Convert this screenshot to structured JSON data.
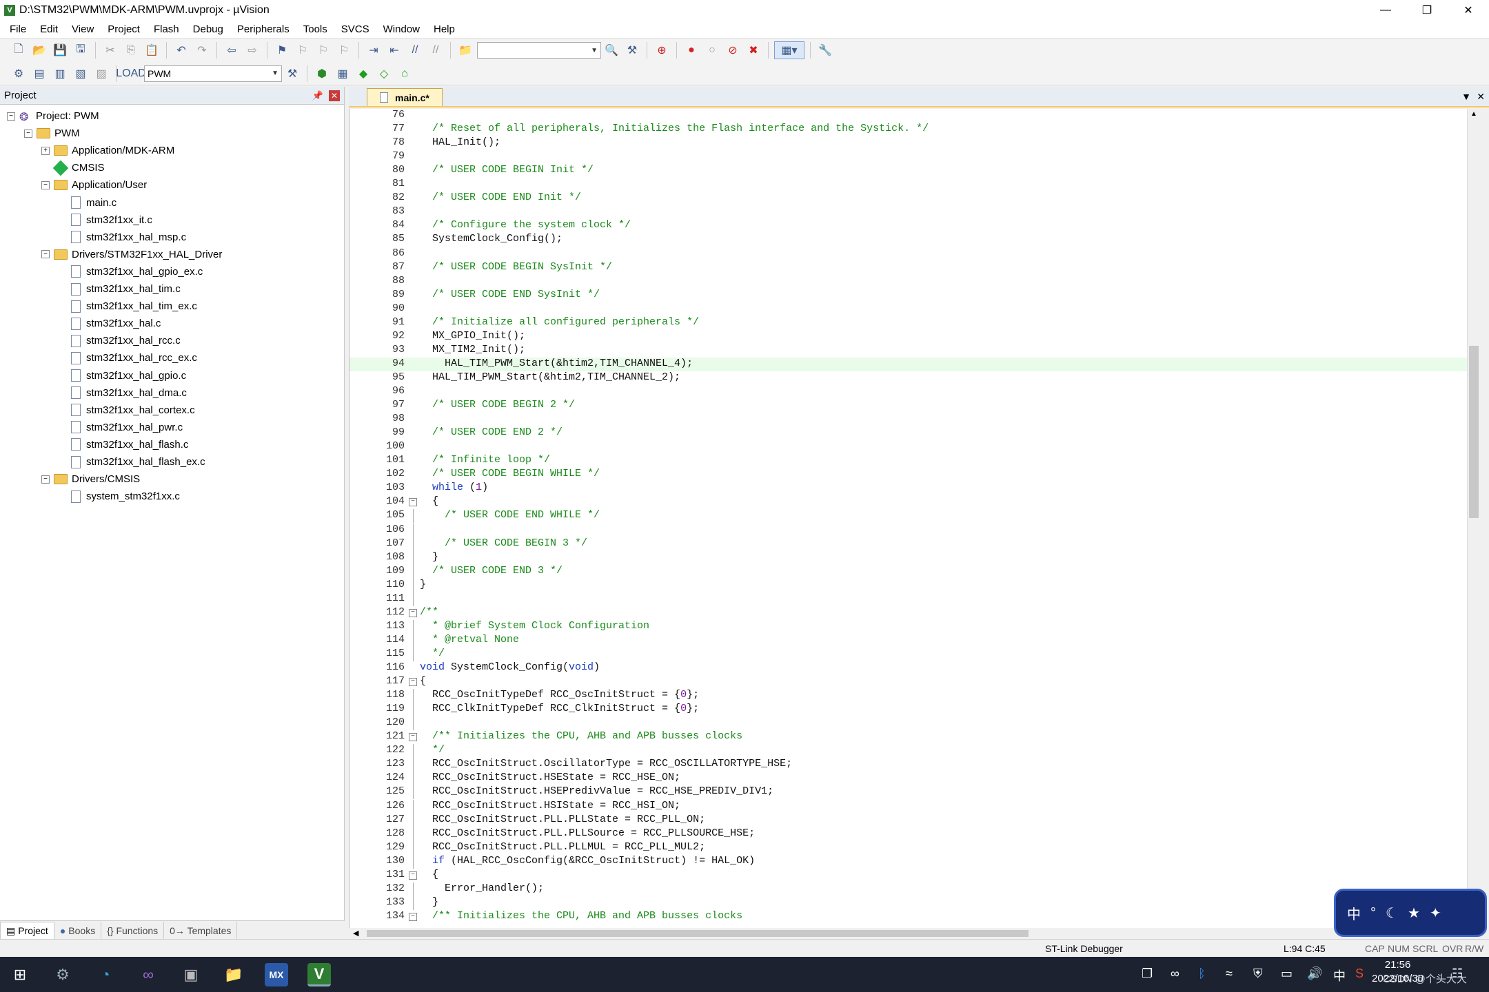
{
  "window": {
    "title": "D:\\STM32\\PWM\\MDK-ARM\\PWM.uvprojx - µVision"
  },
  "menu": [
    "File",
    "Edit",
    "View",
    "Project",
    "Flash",
    "Debug",
    "Peripherals",
    "Tools",
    "SVCS",
    "Window",
    "Help"
  ],
  "toolbar": {
    "target": "PWM"
  },
  "project": {
    "header": "Project",
    "tree": [
      {
        "label": "Project: PWM",
        "depth": 0,
        "kind": "project",
        "exp": "-"
      },
      {
        "label": "PWM",
        "depth": 1,
        "kind": "folder",
        "exp": "-"
      },
      {
        "label": "Application/MDK-ARM",
        "depth": 2,
        "kind": "folder",
        "exp": "+"
      },
      {
        "label": "CMSIS",
        "depth": 2,
        "kind": "gem",
        "exp": ""
      },
      {
        "label": "Application/User",
        "depth": 2,
        "kind": "folder",
        "exp": "-"
      },
      {
        "label": "main.c",
        "depth": 3,
        "kind": "file",
        "exp": ""
      },
      {
        "label": "stm32f1xx_it.c",
        "depth": 3,
        "kind": "file",
        "exp": ""
      },
      {
        "label": "stm32f1xx_hal_msp.c",
        "depth": 3,
        "kind": "file",
        "exp": ""
      },
      {
        "label": "Drivers/STM32F1xx_HAL_Driver",
        "depth": 2,
        "kind": "folder",
        "exp": "-"
      },
      {
        "label": "stm32f1xx_hal_gpio_ex.c",
        "depth": 3,
        "kind": "file",
        "exp": ""
      },
      {
        "label": "stm32f1xx_hal_tim.c",
        "depth": 3,
        "kind": "file",
        "exp": ""
      },
      {
        "label": "stm32f1xx_hal_tim_ex.c",
        "depth": 3,
        "kind": "file",
        "exp": ""
      },
      {
        "label": "stm32f1xx_hal.c",
        "depth": 3,
        "kind": "file",
        "exp": ""
      },
      {
        "label": "stm32f1xx_hal_rcc.c",
        "depth": 3,
        "kind": "file",
        "exp": ""
      },
      {
        "label": "stm32f1xx_hal_rcc_ex.c",
        "depth": 3,
        "kind": "file",
        "exp": ""
      },
      {
        "label": "stm32f1xx_hal_gpio.c",
        "depth": 3,
        "kind": "file",
        "exp": ""
      },
      {
        "label": "stm32f1xx_hal_dma.c",
        "depth": 3,
        "kind": "file",
        "exp": ""
      },
      {
        "label": "stm32f1xx_hal_cortex.c",
        "depth": 3,
        "kind": "file",
        "exp": ""
      },
      {
        "label": "stm32f1xx_hal_pwr.c",
        "depth": 3,
        "kind": "file",
        "exp": ""
      },
      {
        "label": "stm32f1xx_hal_flash.c",
        "depth": 3,
        "kind": "file",
        "exp": ""
      },
      {
        "label": "stm32f1xx_hal_flash_ex.c",
        "depth": 3,
        "kind": "file",
        "exp": ""
      },
      {
        "label": "Drivers/CMSIS",
        "depth": 2,
        "kind": "folder",
        "exp": "-"
      },
      {
        "label": "system_stm32f1xx.c",
        "depth": 3,
        "kind": "file",
        "exp": ""
      }
    ],
    "tabs": [
      "Project",
      "Books",
      "{} Functions",
      "0→ Templates"
    ]
  },
  "editor": {
    "tab": "main.c*",
    "highlight_line": 94,
    "lines": [
      {
        "n": 76,
        "t": "",
        "c": "code",
        "f": ""
      },
      {
        "n": 77,
        "t": "  /* Reset of all peripherals, Initializes the Flash interface and the Systick. */",
        "c": "cmt",
        "f": ""
      },
      {
        "n": 78,
        "t": "  HAL_Init();",
        "c": "code",
        "f": ""
      },
      {
        "n": 79,
        "t": "",
        "c": "code",
        "f": ""
      },
      {
        "n": 80,
        "t": "  /* USER CODE BEGIN Init */",
        "c": "cmt",
        "f": ""
      },
      {
        "n": 81,
        "t": "",
        "c": "code",
        "f": ""
      },
      {
        "n": 82,
        "t": "  /* USER CODE END Init */",
        "c": "cmt",
        "f": ""
      },
      {
        "n": 83,
        "t": "",
        "c": "code",
        "f": ""
      },
      {
        "n": 84,
        "t": "  /* Configure the system clock */",
        "c": "cmt",
        "f": ""
      },
      {
        "n": 85,
        "t": "  SystemClock_Config();",
        "c": "code",
        "f": ""
      },
      {
        "n": 86,
        "t": "",
        "c": "code",
        "f": ""
      },
      {
        "n": 87,
        "t": "  /* USER CODE BEGIN SysInit */",
        "c": "cmt",
        "f": ""
      },
      {
        "n": 88,
        "t": "",
        "c": "code",
        "f": ""
      },
      {
        "n": 89,
        "t": "  /* USER CODE END SysInit */",
        "c": "cmt",
        "f": ""
      },
      {
        "n": 90,
        "t": "",
        "c": "code",
        "f": ""
      },
      {
        "n": 91,
        "t": "  /* Initialize all configured peripherals */",
        "c": "cmt",
        "f": ""
      },
      {
        "n": 92,
        "t": "  MX_GPIO_Init();",
        "c": "code",
        "f": ""
      },
      {
        "n": 93,
        "t": "  MX_TIM2_Init();",
        "c": "code",
        "f": ""
      },
      {
        "n": 94,
        "t": "    HAL_TIM_PWM_Start(&htim2,TIM_CHANNEL_4);",
        "c": "code",
        "f": ""
      },
      {
        "n": 95,
        "t": "  HAL_TIM_PWM_Start(&htim2,TIM_CHANNEL_2);",
        "c": "code",
        "f": ""
      },
      {
        "n": 96,
        "t": "",
        "c": "code",
        "f": ""
      },
      {
        "n": 97,
        "t": "  /* USER CODE BEGIN 2 */",
        "c": "cmt",
        "f": ""
      },
      {
        "n": 98,
        "t": "",
        "c": "code",
        "f": ""
      },
      {
        "n": 99,
        "t": "  /* USER CODE END 2 */",
        "c": "cmt",
        "f": ""
      },
      {
        "n": 100,
        "t": "",
        "c": "code",
        "f": ""
      },
      {
        "n": 101,
        "t": "  /* Infinite loop */",
        "c": "cmt",
        "f": ""
      },
      {
        "n": 102,
        "t": "  /* USER CODE BEGIN WHILE */",
        "c": "cmt",
        "f": ""
      },
      {
        "n": 103,
        "t": "  while (1)",
        "c": "kw",
        "f": ""
      },
      {
        "n": 104,
        "t": "  {",
        "c": "code",
        "f": "box"
      },
      {
        "n": 105,
        "t": "    /* USER CODE END WHILE */",
        "c": "cmt",
        "f": "line"
      },
      {
        "n": 106,
        "t": "",
        "c": "code",
        "f": "line"
      },
      {
        "n": 107,
        "t": "    /* USER CODE BEGIN 3 */",
        "c": "cmt",
        "f": "line"
      },
      {
        "n": 108,
        "t": "  }",
        "c": "code",
        "f": "line"
      },
      {
        "n": 109,
        "t": "  /* USER CODE END 3 */",
        "c": "cmt",
        "f": "line"
      },
      {
        "n": 110,
        "t": "}",
        "c": "code",
        "f": "line"
      },
      {
        "n": 111,
        "t": "",
        "c": "code",
        "f": "line"
      },
      {
        "n": 112,
        "t": "/**",
        "c": "cmt",
        "f": "box"
      },
      {
        "n": 113,
        "t": "  * @brief System Clock Configuration",
        "c": "cmt",
        "f": "line"
      },
      {
        "n": 114,
        "t": "  * @retval None",
        "c": "cmt",
        "f": "line"
      },
      {
        "n": 115,
        "t": "  */",
        "c": "cmt",
        "f": "line"
      },
      {
        "n": 116,
        "t": "void SystemClock_Config(void)",
        "c": "kw",
        "f": ""
      },
      {
        "n": 117,
        "t": "{",
        "c": "code",
        "f": "box"
      },
      {
        "n": 118,
        "t": "  RCC_OscInitTypeDef RCC_OscInitStruct = {0};",
        "c": "code",
        "f": "line"
      },
      {
        "n": 119,
        "t": "  RCC_ClkInitTypeDef RCC_ClkInitStruct = {0};",
        "c": "code",
        "f": "line"
      },
      {
        "n": 120,
        "t": "",
        "c": "code",
        "f": "line"
      },
      {
        "n": 121,
        "t": "  /** Initializes the CPU, AHB and APB busses clocks",
        "c": "cmt",
        "f": "box"
      },
      {
        "n": 122,
        "t": "  */",
        "c": "cmt",
        "f": "line"
      },
      {
        "n": 123,
        "t": "  RCC_OscInitStruct.OscillatorType = RCC_OSCILLATORTYPE_HSE;",
        "c": "code",
        "f": "line"
      },
      {
        "n": 124,
        "t": "  RCC_OscInitStruct.HSEState = RCC_HSE_ON;",
        "c": "code",
        "f": "line"
      },
      {
        "n": 125,
        "t": "  RCC_OscInitStruct.HSEPredivValue = RCC_HSE_PREDIV_DIV1;",
        "c": "code",
        "f": "line"
      },
      {
        "n": 126,
        "t": "  RCC_OscInitStruct.HSIState = RCC_HSI_ON;",
        "c": "code",
        "f": "line"
      },
      {
        "n": 127,
        "t": "  RCC_OscInitStruct.PLL.PLLState = RCC_PLL_ON;",
        "c": "code",
        "f": "line"
      },
      {
        "n": 128,
        "t": "  RCC_OscInitStruct.PLL.PLLSource = RCC_PLLSOURCE_HSE;",
        "c": "code",
        "f": "line"
      },
      {
        "n": 129,
        "t": "  RCC_OscInitStruct.PLL.PLLMUL = RCC_PLL_MUL2;",
        "c": "code",
        "f": "line"
      },
      {
        "n": 130,
        "t": "  if (HAL_RCC_OscConfig(&RCC_OscInitStruct) != HAL_OK)",
        "c": "kw",
        "f": "line"
      },
      {
        "n": 131,
        "t": "  {",
        "c": "code",
        "f": "box"
      },
      {
        "n": 132,
        "t": "    Error_Handler();",
        "c": "code",
        "f": "line"
      },
      {
        "n": 133,
        "t": "  }",
        "c": "code",
        "f": "line"
      },
      {
        "n": 134,
        "t": "  /** Initializes the CPU, AHB and APB busses clocks",
        "c": "cmt",
        "f": "box"
      }
    ]
  },
  "status": {
    "debugger": "ST-Link Debugger",
    "pos": "L:94 C:45",
    "flags": [
      "CAP",
      "NUM",
      "SCRL",
      "OVR",
      "R/W"
    ]
  },
  "taskbar": {
    "time": "21:56",
    "date": "2022/10/30",
    "lang": "中",
    "ime_lang": "中"
  },
  "watermark": "CSDN @个头大大"
}
